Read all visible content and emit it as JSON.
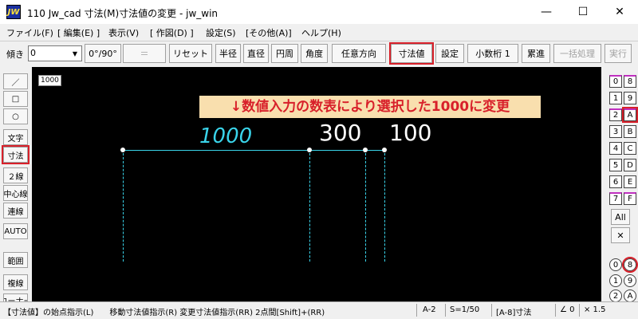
{
  "titlebar": {
    "app_icon_text": "JW",
    "title": "110 Jw_cad 寸法(M)寸法値の変更 - jw_win",
    "minimize": "—",
    "maximize": "☐",
    "close": "✕"
  },
  "menu": [
    "ファイル(F)",
    "[ 編集(E) ]",
    "表示(V)",
    "[ 作図(D) ]",
    "設定(S)",
    "[その他(A)]",
    "ヘルプ(H)"
  ],
  "toolbar": {
    "tilt_label": "傾き",
    "tilt_value": "0",
    "dropdown_glyph": "▼",
    "buttons": {
      "angle": "0°/90°",
      "equals": "＝",
      "reset": "リセット",
      "radius": "半径",
      "diameter": "直径",
      "circumference": "円周",
      "angle_dim": "角度",
      "any_direction": "任意方向",
      "dim_value": "寸法値",
      "settings": "設定",
      "decimal": "小数桁 1",
      "cumulative": "累進",
      "batch": "一括処理",
      "execute": "実行"
    }
  },
  "left_tools": [
    "／",
    "□",
    "○",
    "文字",
    "寸法",
    "２線",
    "中心線",
    "連線",
    "AUTO",
    "範囲",
    "複線",
    "コーナー"
  ],
  "canvas": {
    "scale_badge": "1000",
    "banner": "↓数値入力の数表により選択した1000に変更",
    "dims": {
      "d1": "1000",
      "d2": "300",
      "d3": "100"
    }
  },
  "layers": {
    "left": [
      "0",
      "1",
      "2",
      "3",
      "4",
      "5",
      "6",
      "7"
    ],
    "right": [
      "8",
      "9",
      "A",
      "B",
      "C",
      "D",
      "E",
      "F"
    ],
    "all": "All",
    "x_glyph": "✕",
    "circled_left": [
      "0",
      "1",
      "2"
    ],
    "circled_right": [
      "8",
      "9",
      "A"
    ]
  },
  "status": {
    "hint": "【寸法値】の始点指示(L)　　移動寸法値指示(R)  変更寸法値指示(RR) 2点間[Shift]+(RR)",
    "layer_group": "A-2",
    "scale": "S=1/50",
    "layer": "[A-8]寸法",
    "angle": "∠ 0",
    "mult": "× 1.5"
  },
  "colors": {
    "highlight": "#d8202a",
    "dim_cyan": "#3ad4ea",
    "banner_bg": "#f9dfae",
    "layer_magenta": "#c030c0"
  }
}
